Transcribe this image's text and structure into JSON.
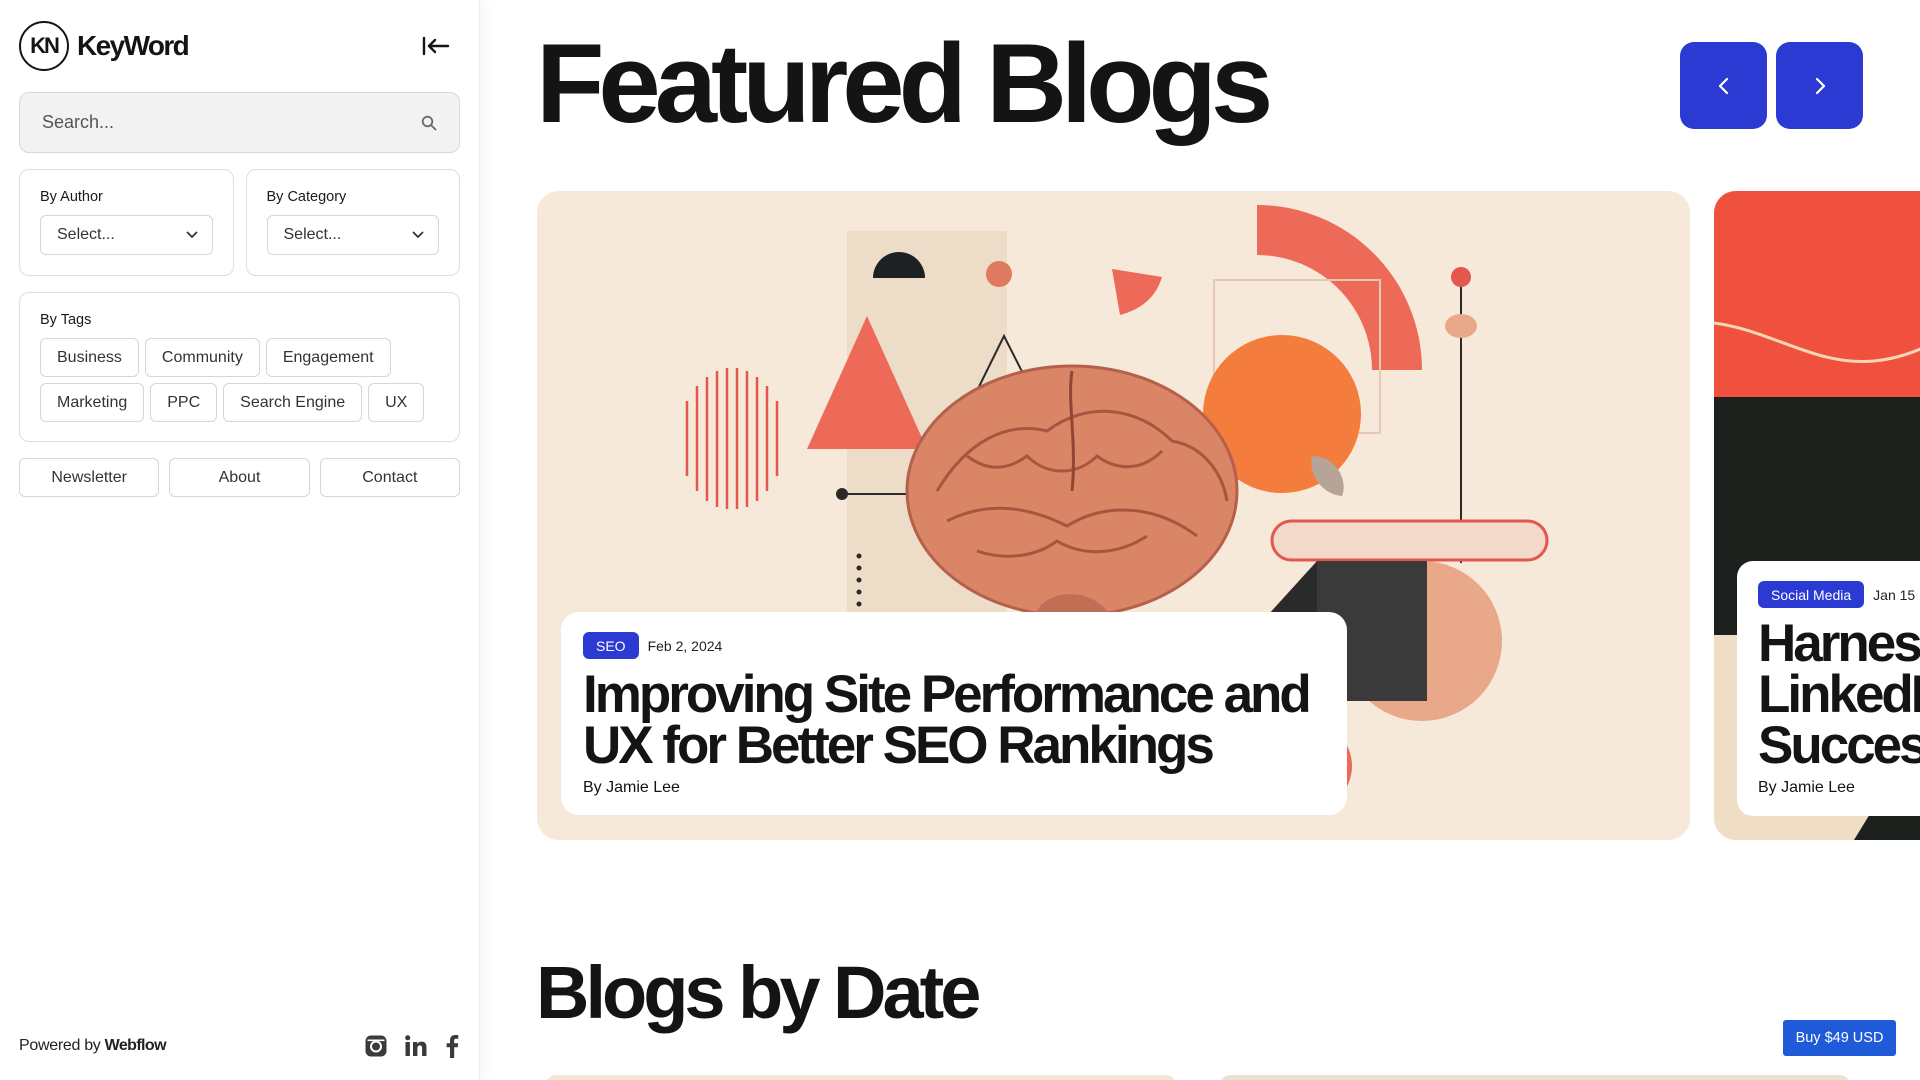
{
  "brand": {
    "logo_text": "KN",
    "name": "KeyWord"
  },
  "search": {
    "placeholder": "Search..."
  },
  "filters": {
    "author": {
      "label": "By Author",
      "selected": "Select..."
    },
    "category": {
      "label": "By Category",
      "selected": "Select..."
    }
  },
  "tags": {
    "label": "By Tags",
    "items": [
      "Business",
      "Community",
      "Engagement",
      "Marketing",
      "PPC",
      "Search Engine",
      "UX"
    ]
  },
  "links": [
    "Newsletter",
    "About",
    "Contact"
  ],
  "footer": {
    "powered_prefix": "Powered by ",
    "powered_brand": "Webflow"
  },
  "socials": [
    "instagram-icon",
    "linkedin-icon",
    "facebook-icon"
  ],
  "featured": {
    "title": "Featured Blogs",
    "cards": [
      {
        "category": "SEO",
        "date": "Feb 2, 2024",
        "title_line1": "Improving Site Performance and",
        "title_line2": "UX for Better SEO Rankings",
        "author": "By Jamie Lee"
      },
      {
        "category": "Social Media",
        "date": "Jan 15",
        "title_line1": "Harness",
        "title_line2": "LinkedI",
        "title_line3": "Succes",
        "author": "By Jamie Lee"
      }
    ]
  },
  "by_date": {
    "title": "Blogs by Date"
  },
  "buy": {
    "label": "Buy $49 USD"
  },
  "colors": {
    "accent": "#2b3ad2",
    "card_bg": "#f7e9da",
    "buy": "#1f5bd9"
  }
}
